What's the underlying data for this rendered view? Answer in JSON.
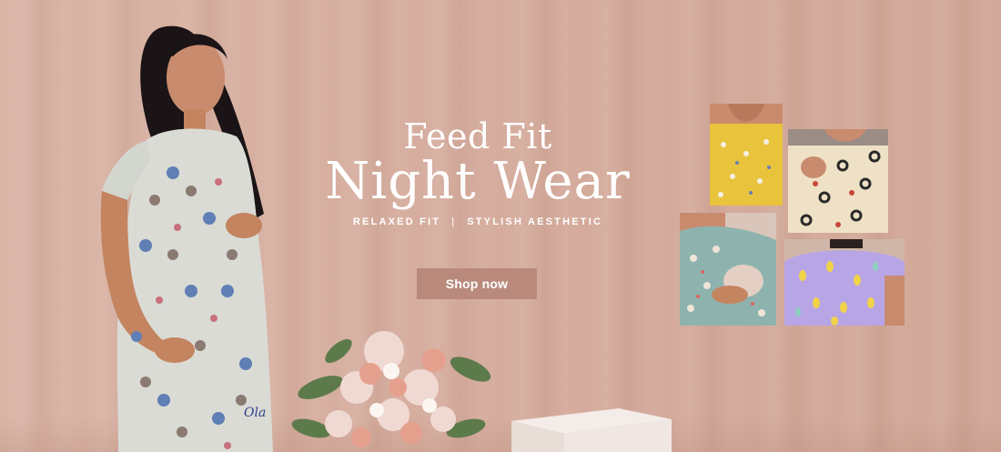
{
  "banner": {
    "title_line1": "Feed Fit",
    "title_line2": "Night Wear",
    "tagline_left": "RELAXED FIT",
    "tagline_sep": "|",
    "tagline_right": "STYLISH AESTHETIC",
    "shop_button": "Shop now",
    "logo_text": "Ola",
    "colors": {
      "background": "#d6ae9f",
      "button": "#b98a7c",
      "text": "#ffffff"
    }
  },
  "thumbnails": [
    {
      "name": "yellow-print-nightwear"
    },
    {
      "name": "cream-print-nightwear"
    },
    {
      "name": "teal-print-nightwear"
    },
    {
      "name": "lavender-dot-nightwear"
    }
  ]
}
